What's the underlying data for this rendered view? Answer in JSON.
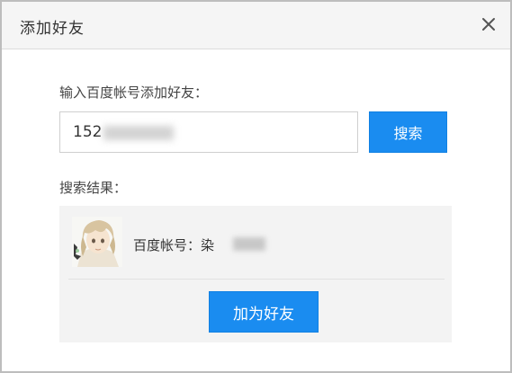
{
  "dialog": {
    "title": "添加好友",
    "close_icon": "close-icon"
  },
  "search": {
    "prompt": "输入百度帐号添加好友：",
    "value": "152",
    "button_label": "搜索"
  },
  "results": {
    "label": "搜索结果：",
    "account_text": "百度帐号：染",
    "add_button_label": "加为好友"
  },
  "colors": {
    "accent": "#1a8cf0",
    "panel_bg": "#f3f3f3",
    "titlebar_bg": "#f5f5f5"
  }
}
